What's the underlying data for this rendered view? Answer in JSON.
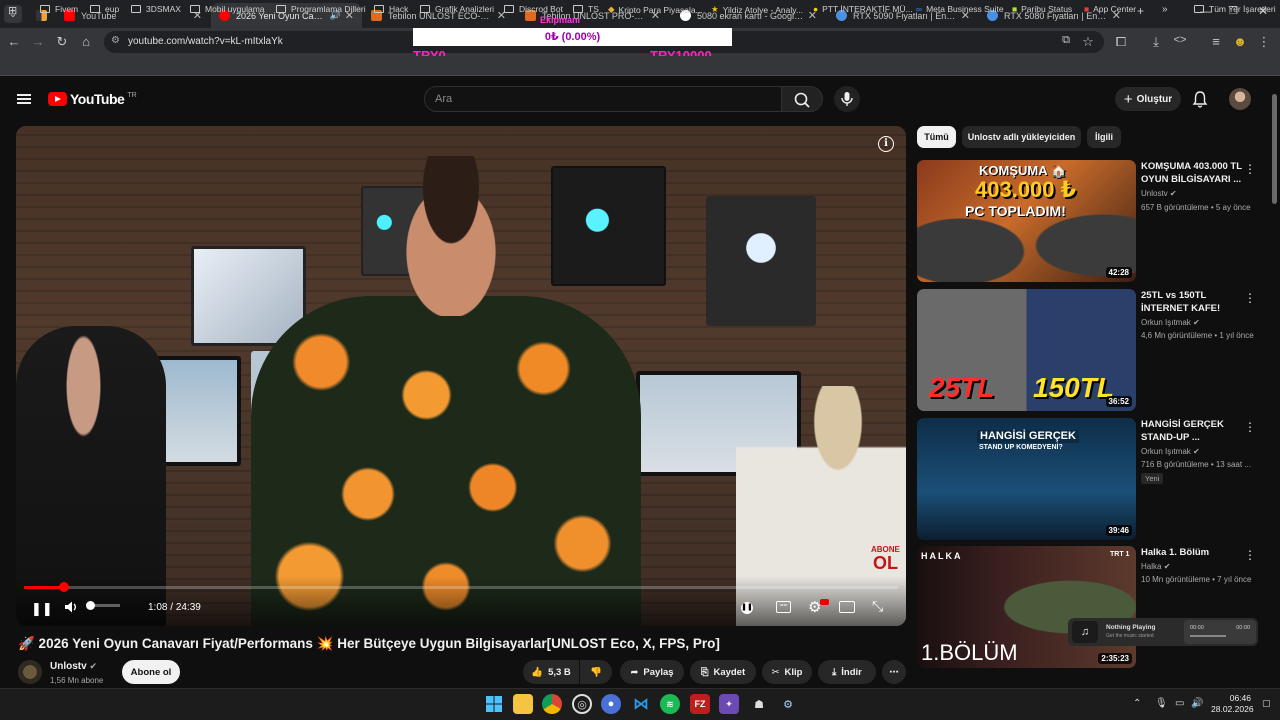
{
  "browser": {
    "tabs": [
      {
        "title": "",
        "color": "#e8a33a"
      },
      {
        "title": "YouTube",
        "color": "#ff0000"
      },
      {
        "title": "2026 Yeni Oyun Canav",
        "color": "#ff0000"
      },
      {
        "title": "Tebilon UNLOST ECO-Amd Ry",
        "color": "#e06a1e"
      },
      {
        "title": "Tebilon UNLOST PRO-Amd Ry",
        "color": "#e06a1e"
      },
      {
        "title": "5080 ekran kartı - Google'da A",
        "color": "#dddddd"
      },
      {
        "title": "RTX 5090 Fiyatları | En Ucuzu",
        "color": "#4a90e2"
      },
      {
        "title": "RTX 5080 Fiyatları | En Ucuzu",
        "color": "#4a90e2"
      }
    ],
    "url": "youtube.com/watch?v=kL-mItxlaYk",
    "overlay": {
      "label": "Ekipmanı",
      "value": "0₺ (0.00%)",
      "left": "TRY0",
      "right": "TRY10000"
    },
    "bookmarks": [
      "Fivem",
      "eup",
      "3DSMAX",
      "Mobil uygulama",
      "Programlama Dilleri",
      "Hack",
      "Grafik Analizleri",
      "Discrod Bot",
      "TS",
      "Kripto Para Piyasala...",
      "Yildiz Atolye - Analy...",
      "PTT İNTERAKTİF MÜ...",
      "Meta Business Suite",
      "Paribu Status",
      "App Center",
      "Tüm Yer İşaretleri"
    ]
  },
  "youtube": {
    "logo": "YouTube",
    "region": "TR",
    "search_placeholder": "Ara",
    "create_label": "Oluştur",
    "player": {
      "current_time": "1:08",
      "separator": " / ",
      "duration": "24:39",
      "progress_fraction": 0.046,
      "watermark_top": "ABONE",
      "watermark_bottom": "OL"
    },
    "video_title": "🚀 2026 Yeni Oyun Canavarı Fiyat/Performans 💥 Her Bütçeye Uygun Bilgisayarlar[UNLOST Eco, X, FPS, Pro]",
    "channel": {
      "name": "Unlostv",
      "subscribers": "1,56 Mn abone",
      "subscribe_label": "Abone ol"
    },
    "actions": {
      "likes": "5,3 B",
      "share": "Paylaş",
      "save": "Kaydet",
      "clip": "Klip",
      "download": "İndir"
    },
    "chips": [
      "Tümü",
      "Unlostv adlı yükleyiciden",
      "İlgili"
    ],
    "recommendations": [
      {
        "title_line1": "KOMŞUMA 403.000 TL",
        "title_line2": "OYUN BİLGİSAYARI ...",
        "channel": "Unlostv",
        "meta": "657 B görüntüleme • 5 ay önce",
        "duration": "42:28",
        "thumb_text1": "KOMŞUMA 🏠",
        "thumb_text2": "403.000 ₺",
        "thumb_text3": "PC TOPLADIM!"
      },
      {
        "title_line1": "25TL vs 150TL",
        "title_line2": "İNTERNET KAFE!",
        "channel": "Orkun Işıtmak",
        "meta": "4,6 Mn görüntüleme • 1 yıl önce",
        "duration": "36:52",
        "thumb_text1": "25TL",
        "thumb_text2": "150TL"
      },
      {
        "title_line1": "HANGİSİ GERÇEK",
        "title_line2": "STAND-UP ...",
        "channel": "Orkun Işıtmak",
        "meta": "716 B görüntüleme • 13 saat ...",
        "badge": "Yeni",
        "duration": "39:46",
        "thumb_text1": "HANGİSİ GERÇEK",
        "thumb_text2": "STAND UP KOMEDYENİ?"
      },
      {
        "title_line1": "Halka 1. Bölüm",
        "title_line2": "",
        "channel": "Halka",
        "meta": "10 Mn görüntüleme • 7 yıl önce",
        "duration": "2:35:23",
        "thumb_text1": "HALKA",
        "thumb_text2": "1.BÖLÜM",
        "thumb_text3": "TRT 1"
      }
    ],
    "music": {
      "status": "Nothing Playing",
      "sub": "Get the music started",
      "t1": "00:00",
      "t2": "00:00"
    }
  },
  "taskbar": {
    "time": "06:46",
    "date": "28.02.2026"
  }
}
